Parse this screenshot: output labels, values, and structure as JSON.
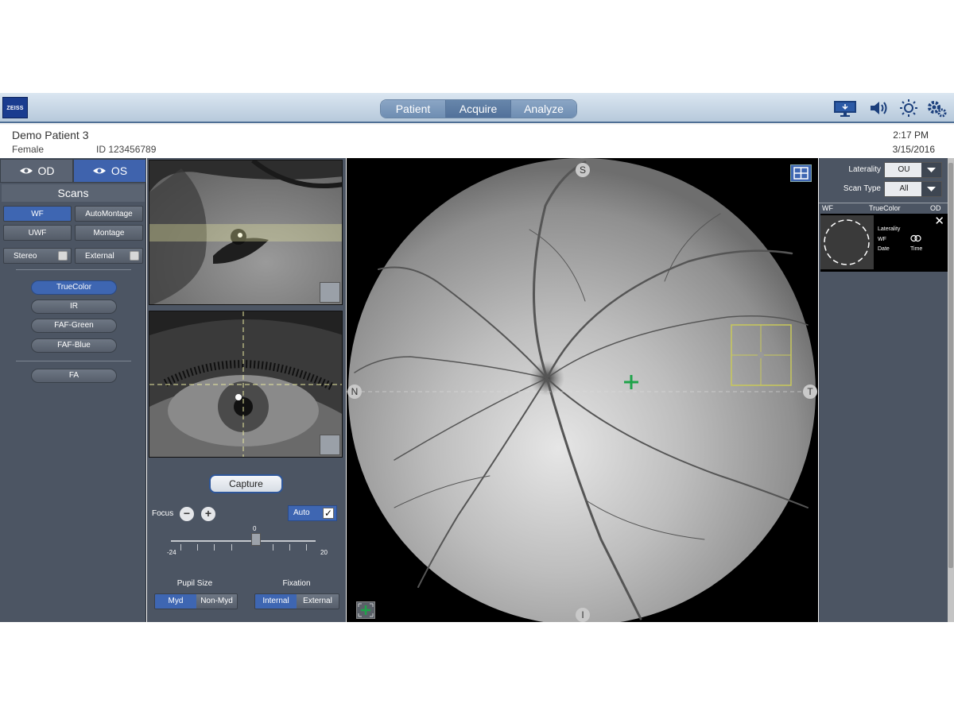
{
  "topbar": {
    "logo": "ZEISS",
    "tabs": [
      {
        "label": "Patient"
      },
      {
        "label": "Acquire"
      },
      {
        "label": "Analyze"
      }
    ],
    "active_tab": "Acquire",
    "icons": [
      "monitor-icon",
      "speaker-icon",
      "brightness-icon",
      "settings-icon"
    ]
  },
  "patient": {
    "name": "Demo Patient 3",
    "sex": "Female",
    "id": "ID 123456789",
    "time": "2:17 PM",
    "date": "3/15/2016"
  },
  "left": {
    "eye_tabs": [
      {
        "label": "OD"
      },
      {
        "label": "OS"
      }
    ],
    "active_eye": "OS",
    "scans_title": "Scans",
    "scan_buttons": [
      {
        "label": "WF",
        "selected": true
      },
      {
        "label": "AutoMontage",
        "selected": false
      },
      {
        "label": "UWF",
        "selected": false
      },
      {
        "label": "Montage",
        "selected": false
      }
    ],
    "checkbox_buttons": [
      {
        "label": "Stereo",
        "checked": false
      },
      {
        "label": "External",
        "checked": false
      }
    ],
    "modes": [
      {
        "label": "TrueColor",
        "selected": true
      },
      {
        "label": "IR",
        "selected": false
      },
      {
        "label": "FAF-Green",
        "selected": false
      },
      {
        "label": "FAF-Blue",
        "selected": false
      }
    ],
    "fa_label": "FA"
  },
  "camera": {
    "capture_label": "Capture",
    "focus_label": "Focus",
    "focus_min_label": "-24",
    "focus_max_label": "20",
    "focus_value_label": "0",
    "focus_value": 0,
    "auto_label": "Auto",
    "auto_checked": true,
    "auto_check_glyph": "✓",
    "pupil_title": "Pupil Size",
    "pupil_options": [
      {
        "label": "Myd",
        "selected": true
      },
      {
        "label": "Non-Myd",
        "selected": false
      }
    ],
    "fixation_title": "Fixation",
    "fixation_options": [
      {
        "label": "Internal",
        "selected": true
      },
      {
        "label": "External",
        "selected": false
      }
    ],
    "minus_glyph": "−",
    "plus_glyph": "+"
  },
  "fundus": {
    "orient_top": "S",
    "orient_left": "N",
    "orient_right": "T",
    "orient_bottom": "I"
  },
  "right": {
    "laterality_label": "Laterality",
    "laterality_value": "OU",
    "scantype_label": "Scan Type",
    "scantype_value": "All",
    "thumb_header": {
      "col1": "WF",
      "col2": "TrueColor",
      "col3": "OD"
    },
    "thumb_meta": {
      "laterality": "Laterality",
      "wf": "WF",
      "date": "Date",
      "time": "Time"
    },
    "close_glyph": "✕"
  },
  "colors": {
    "accent": "#3e66b2",
    "panel": "#4c5563",
    "focus_cross": "#1fa34a",
    "macula_box": "#c8c85a"
  }
}
